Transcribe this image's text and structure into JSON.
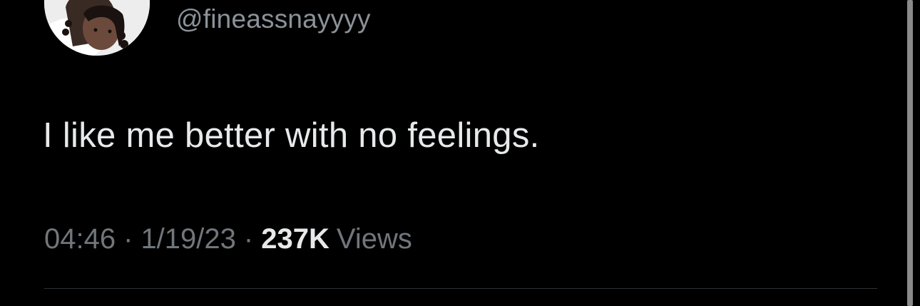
{
  "author": {
    "handle": "@fineassnayyyy",
    "avatar_icon": "profile-photo"
  },
  "tweet": {
    "text": "I like me better with no feelings.",
    "time": "04:46",
    "separator": "·",
    "date": "1/19/23",
    "views_count": "237K",
    "views_label": "Views"
  },
  "colors": {
    "background": "#000000",
    "primary_text": "#e7e9ea",
    "secondary_text": "#71767b",
    "divider": "#2f3336"
  }
}
